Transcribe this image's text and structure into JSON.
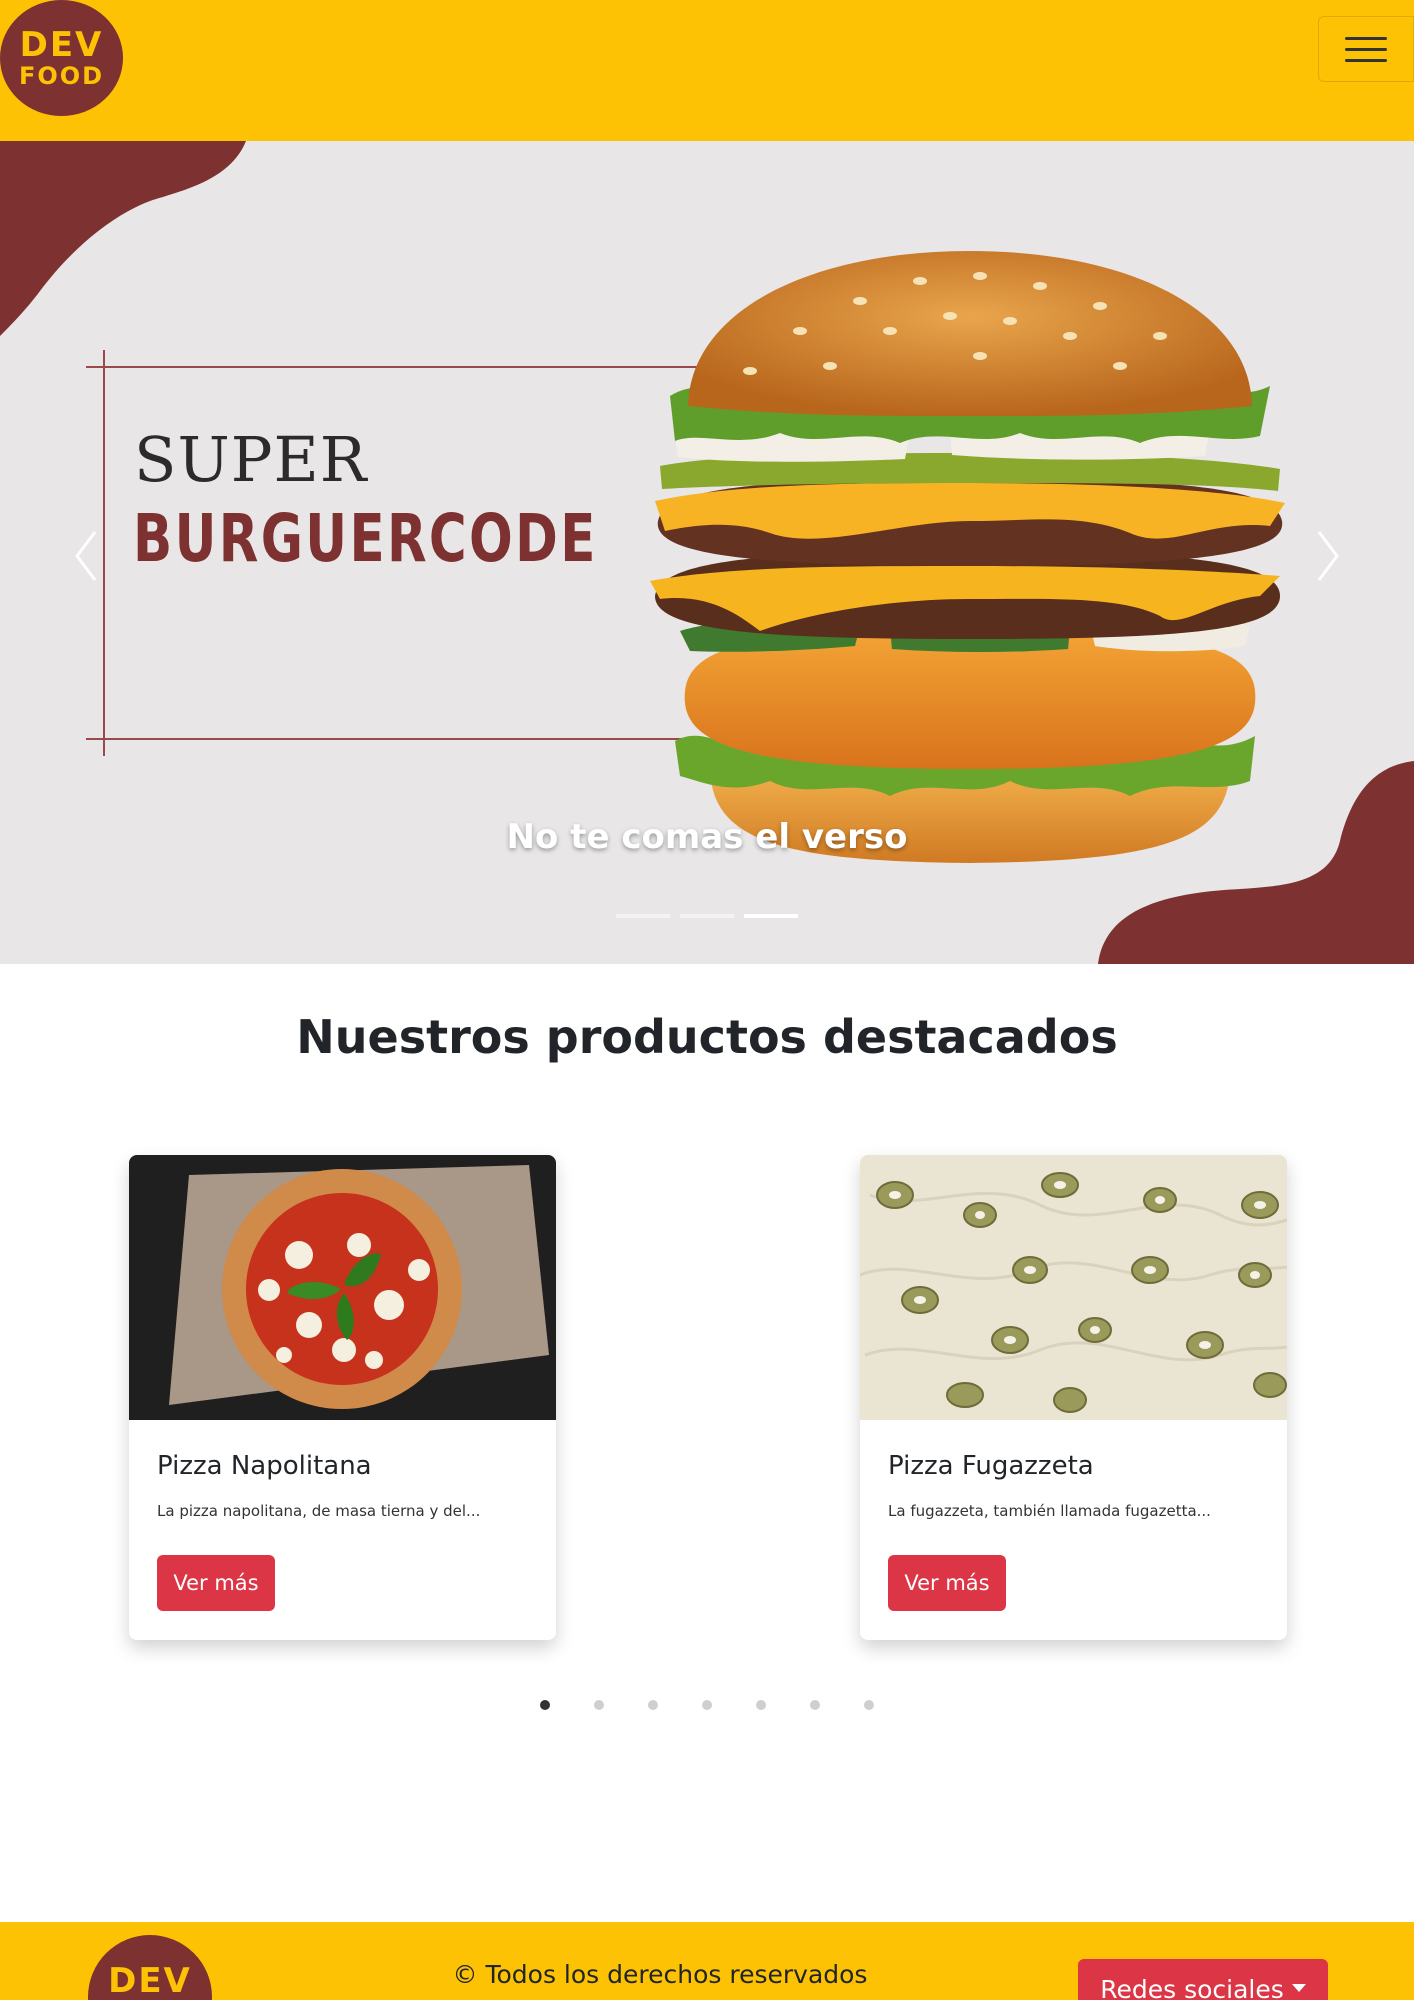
{
  "brand": {
    "logo_line1": "DEV",
    "logo_line2": "FOOD"
  },
  "hero": {
    "title_line1": "SUPER",
    "title_line2": "BURGUERCODE",
    "caption": "No te comas el verso",
    "slides": 3,
    "active_slide": 3
  },
  "products": {
    "heading": "Nuestros productos destacados",
    "cards": [
      {
        "title": "Pizza Napolitana",
        "text": "La pizza napolitana, de masa tierna y del...",
        "button": "Ver más"
      },
      {
        "title": "Pizza Fugazzeta",
        "text": "La fugazzeta, también llamada fugazetta...",
        "button": "Ver más"
      }
    ],
    "pages": 7,
    "active_page": 1
  },
  "footer": {
    "logo_text": "DEV",
    "copyright": "© Todos los derechos reservados",
    "social_button": "Redes sociales"
  },
  "colors": {
    "yellow": "#fdc204",
    "maroon": "#7d3131",
    "red": "#dc3545"
  }
}
